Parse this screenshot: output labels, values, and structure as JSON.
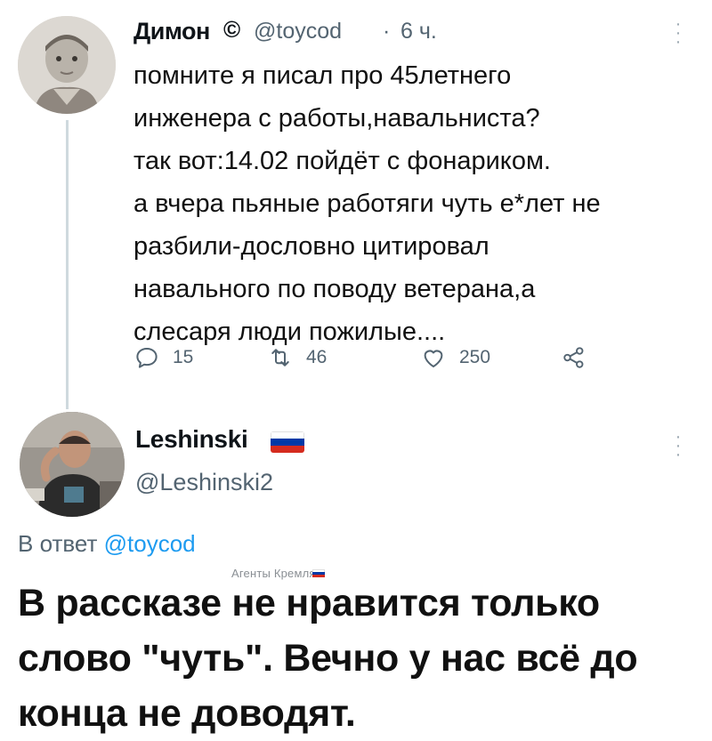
{
  "tweet1": {
    "author_name": "Димон",
    "author_name_suffix": "©",
    "handle": "@toycod",
    "separator": "·",
    "time": "6 ч.",
    "body": "помните я писал про 45летнего\nинженера с работы,навальниста?\nтак вот:14.02 пойдёт с фонариком.\nа вчера пьяные работяги чуть е*лет не\nразбили-дословно цитировал\nнавального по поводу ветерана,а\nслесаря люди пожилые....",
    "replies": "15",
    "retweets": "46",
    "likes": "250",
    "more_icon": "more-vertical-icon",
    "avatar_icon": "avatar-photo-child"
  },
  "tweet2": {
    "author_name": "Leshinski",
    "flag_icon": "russia-flag-icon",
    "handle": "@Leshinski2",
    "reply_prefix": "В ответ",
    "reply_mention": "@toycod",
    "body": "В рассказе не нравится только\nслово \"чуть\". Вечно у нас всё до\nконца не доводят.",
    "more_icon": "more-vertical-icon",
    "avatar_icon": "avatar-photo-man"
  },
  "watermark": {
    "text": "Агенты Кремля",
    "flag_icon": "russia-flag-icon"
  },
  "colors": {
    "text": "#0f1419",
    "muted": "#536471",
    "link": "#1d9bf0",
    "thread_line": "#cfd9de",
    "flag_white": "#ffffff",
    "flag_blue": "#0039a6",
    "flag_red": "#d52b1e"
  }
}
